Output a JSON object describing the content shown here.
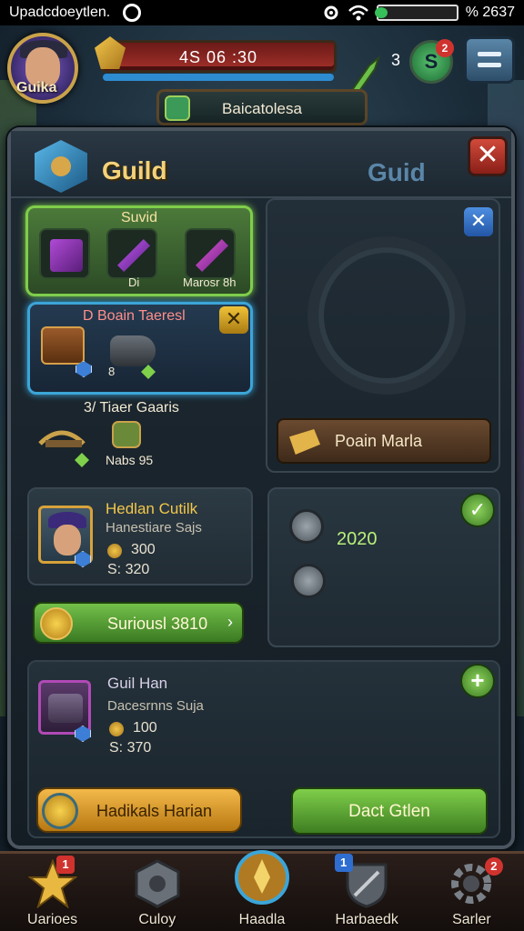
{
  "status_bar": {
    "title": "Upadcdoeytlen.",
    "right_text": "% 2637"
  },
  "hud": {
    "player_name": "Guika",
    "resource_value": "4S 06 :30",
    "level": "3",
    "coin_letter": "S",
    "coin_badge": "2"
  },
  "banner": {
    "text": "Baicatolesa"
  },
  "panel": {
    "title": "Guild",
    "title_right": "Guid",
    "close_symbol": "✕"
  },
  "reward_card": {
    "title": "Suvid",
    "item2_caption": "Di",
    "item3_caption": "Marosr 8h"
  },
  "quest_card": {
    "title": "D  Boain Taeresl",
    "close_symbol": "✕",
    "item_caption": "8"
  },
  "gear_row": {
    "title": "3/  Tiaer Gaaris",
    "sub": "Nabs 95"
  },
  "preview": {
    "close_symbol": "✕",
    "button_label": "Poain Marla"
  },
  "member1": {
    "name": "Hedlan Cutilk",
    "role": "Hanestiare Sajs",
    "gold": "300",
    "score": "S: 320"
  },
  "member1_button": {
    "label": "Suriousl 3810",
    "arrow": "›"
  },
  "right_box": {
    "value": "2020",
    "check": "✓"
  },
  "member2": {
    "name": "Guil Han",
    "role": "Dacesrnns Suja",
    "gold": "100",
    "score": "S: 370"
  },
  "plus": "+",
  "buttons": {
    "orange": "Hadikals Harian",
    "green": "Dact Gtlen"
  },
  "nav": [
    {
      "label": "Uarioes",
      "badge": "1"
    },
    {
      "label": "Culoy",
      "badge": ""
    },
    {
      "label": "Haadla",
      "badge": ""
    },
    {
      "label": "Harbaedk",
      "badge": "1"
    },
    {
      "label": "Sarler",
      "badge": "2"
    }
  ],
  "colors": {
    "accent_gold": "#f4d27a",
    "accent_green": "#7fce4a",
    "accent_blue": "#3ca5d8",
    "danger": "#d04a3a"
  },
  "icons": {
    "status": [
      "camera-icon",
      "settings-icon",
      "wifi-icon",
      "battery-icon"
    ],
    "nav": [
      "star-icon",
      "shield-hex-icon",
      "sword-emblem-icon",
      "crest-icon",
      "gear-icon"
    ]
  }
}
